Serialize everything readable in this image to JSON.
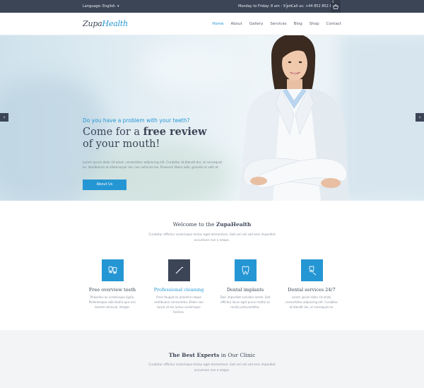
{
  "topbar": {
    "language": "Language: English",
    "hours": "Monday to Friday: 8 am - 9 pm",
    "phone": "Call us: +44 852 852 888",
    "cart_count": "0"
  },
  "header": {
    "logo_main": "Zupa",
    "logo_accent": "Health",
    "nav": [
      "Home",
      "About",
      "Gallery",
      "Services",
      "Blog",
      "Shop",
      "Contact"
    ]
  },
  "hero": {
    "subtitle": "Do you have a problem with your teeth?",
    "heading_pre": "Come for a ",
    "heading_bold": "free review",
    "heading_line2": "of your mouth!",
    "body": "Lorem ipsum dolor sit amet, consectetur adipiscing elit. Curabitur at blandit dui, ut consequat ex. Vestibulum at ullamcorper leo, nec vehicula leo. Praesent libero odio, gravida ut velit et.",
    "cta": "About Us"
  },
  "welcome": {
    "title_pre": "Welcome to the ",
    "title_bold": "ZupaHealth",
    "description": "Curabitur efficitur scelerisque lectus eget elementum. Sed vel nisl sed eros imperdiet accumsan non a neque."
  },
  "features": [
    {
      "title": "Free overview teeth",
      "desc": "Phasellus eu scelerisque ligula. Pellentesque sollicitudin quis orci laoreet vehicula. Integer."
    },
    {
      "title": "Professional cleaning",
      "desc": "Proin feugiat ex pharetra neque vestibulum consectetur. Etiam non turpis et leo luctus scelerisque facilisis."
    },
    {
      "title": "Dental implants",
      "desc": "Duis imperdiet convallis lorem. Sed efficitur lacus eget purus mattis ac mollis justo porttitor."
    },
    {
      "title": "Dental services 24/7",
      "desc": "Lorem ipsum dolor sit amet, consectetur adipiscing elit. Curabitur at blandit dui, ut consequat ex."
    }
  ],
  "experts": {
    "title_bold": "The Best Experts",
    "title_rest": " in Our Clinic",
    "description": "Curabitur efficitur scelerisque lectus eget elementum. Sed vel nisl sed eros imperdiet accumsan non a neque."
  },
  "colors": {
    "accent": "#2596d4",
    "dark": "#3c4556",
    "section_bg": "#f3f4f6"
  }
}
